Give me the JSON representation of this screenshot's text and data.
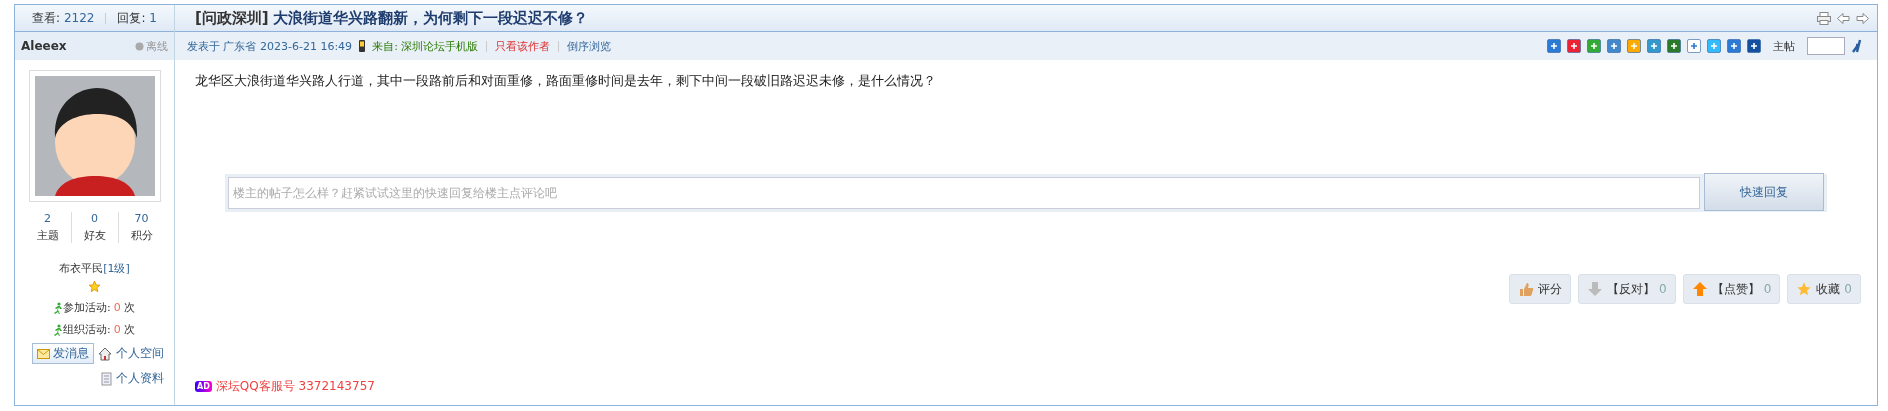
{
  "sidebar": {
    "stats_header": {
      "views_label": "查看:",
      "views": "2122",
      "replies_label": "回复:",
      "replies": "1"
    },
    "user": {
      "name": "Aleeex",
      "status": "离线",
      "online": false
    },
    "counts": [
      {
        "value": "2",
        "label": "主题"
      },
      {
        "value": "0",
        "label": "好友"
      },
      {
        "value": "70",
        "label": "积分"
      }
    ],
    "rank": {
      "title": "布衣平民",
      "level": "[1级]"
    },
    "activities": [
      {
        "label": "参加活动:",
        "count": "0",
        "unit": "次"
      },
      {
        "label": "组织活动:",
        "count": "0",
        "unit": "次"
      }
    ],
    "links": [
      {
        "kind": "button",
        "label": "发消息"
      },
      {
        "kind": "home",
        "label": "个人空间"
      },
      {
        "kind": "doc",
        "label": "个人资料"
      }
    ]
  },
  "post": {
    "tag": "[问政深圳]",
    "title": "大浪街道华兴路翻新，为何剩下一段迟迟不修？",
    "meta": {
      "posted": "发表于 广东省 2023-6-21 16:49",
      "from_label": "来自:",
      "from": "深圳论坛手机版",
      "author_only": "只看该作者",
      "reverse": "倒序浏览"
    },
    "floor_label": "主帖",
    "body": "龙华区大浪街道华兴路人行道，其中一段路前后和对面重修，路面重修时间是去年，剩下中间一段破旧路迟迟未修，是什么情况？",
    "quick_reply": {
      "placeholder": "楼主的帖子怎么样？赶紧试试这里的快速回复给楼主点评论吧",
      "button": "快速回复"
    },
    "actions": [
      {
        "kind": "rate",
        "label": "评分"
      },
      {
        "kind": "down",
        "label": "【反对】",
        "count": "0"
      },
      {
        "kind": "up",
        "label": "【点赞】",
        "count": "0"
      },
      {
        "kind": "fav",
        "label": "收藏",
        "count": "0"
      }
    ],
    "ad": {
      "badge": "AD",
      "text": "深坛QQ客服号 3372143757"
    }
  }
}
